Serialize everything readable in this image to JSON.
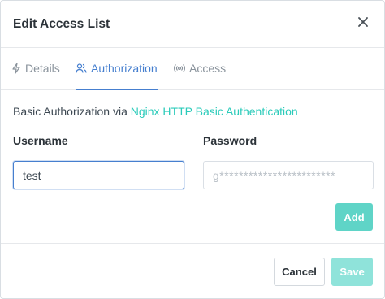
{
  "modal": {
    "title": "Edit Access List",
    "close_icon": "close-icon"
  },
  "tabs": [
    {
      "label": "Details",
      "icon": "lightning-icon",
      "active": false
    },
    {
      "label": "Authorization",
      "icon": "users-icon",
      "active": true
    },
    {
      "label": "Access",
      "icon": "broadcast-icon",
      "active": false
    }
  ],
  "auth": {
    "intro_text": "Basic Authorization via ",
    "intro_link": "Nginx HTTP Basic Authentication",
    "username_label": "Username",
    "password_label": "Password",
    "username_value": "test",
    "password_placeholder": "g************************"
  },
  "buttons": {
    "add": "Add",
    "cancel": "Cancel",
    "save": "Save"
  },
  "colors": {
    "accent": "#467fcf",
    "teal": "#2bcbba",
    "add_button": "#5fd4c7",
    "save_button_disabled": "#8fe3da"
  }
}
